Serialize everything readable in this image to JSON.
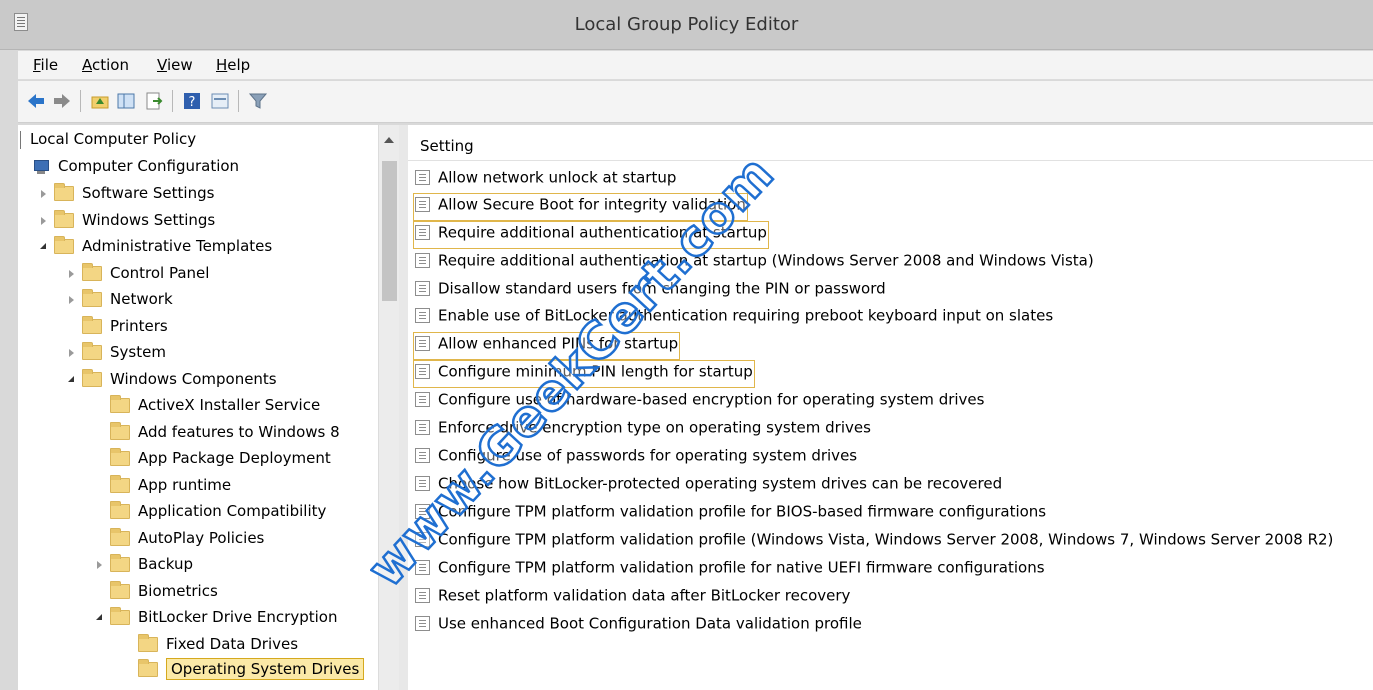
{
  "window": {
    "title": "Local Group Policy Editor"
  },
  "menu": {
    "items": [
      {
        "label": "File",
        "u": "F",
        "rest": "ile"
      },
      {
        "label": "Action",
        "u": "A",
        "rest": "ction"
      },
      {
        "label": "View",
        "u": "V",
        "rest": "iew"
      },
      {
        "label": "Help",
        "u": "H",
        "rest": "elp"
      }
    ]
  },
  "toolbar": {
    "icons": [
      "back-arrow-icon",
      "forward-arrow-icon",
      "up-folder-icon",
      "show-hide-tree-icon",
      "export-list-icon",
      "help-icon",
      "properties-icon",
      "filter-icon"
    ]
  },
  "tree": {
    "items": [
      {
        "label": "Local Computer Policy"
      },
      {
        "label": "Computer Configuration"
      },
      {
        "label": "Software Settings"
      },
      {
        "label": "Windows Settings"
      },
      {
        "label": "Administrative Templates"
      },
      {
        "label": "Control Panel"
      },
      {
        "label": "Network"
      },
      {
        "label": "Printers"
      },
      {
        "label": "System"
      },
      {
        "label": "Windows Components"
      },
      {
        "label": "ActiveX Installer Service"
      },
      {
        "label": "Add features to Windows 8"
      },
      {
        "label": "App Package Deployment"
      },
      {
        "label": "App runtime"
      },
      {
        "label": "Application Compatibility"
      },
      {
        "label": "AutoPlay Policies"
      },
      {
        "label": "Backup"
      },
      {
        "label": "Biometrics"
      },
      {
        "label": "BitLocker Drive Encryption"
      },
      {
        "label": "Fixed Data Drives"
      },
      {
        "label": "Operating System Drives"
      }
    ]
  },
  "list": {
    "column_header": "Setting",
    "settings": [
      {
        "label": "Allow network unlock at startup"
      },
      {
        "label": "Allow Secure Boot for integrity validation"
      },
      {
        "label": "Require additional authentication at startup"
      },
      {
        "label": "Require additional authentication at startup (Windows Server 2008 and Windows Vista)"
      },
      {
        "label": "Disallow standard users from changing the PIN or password"
      },
      {
        "label": "Enable use of BitLocker authentication requiring preboot keyboard input on slates"
      },
      {
        "label": "Allow enhanced PINs for startup"
      },
      {
        "label": "Configure minimum PIN length for startup"
      },
      {
        "label": "Configure use of hardware-based encryption for operating system drives"
      },
      {
        "label": "Enforce drive encryption type on operating system drives"
      },
      {
        "label": "Configure use of passwords for operating system drives"
      },
      {
        "label": "Choose how BitLocker-protected operating system drives can be recovered"
      },
      {
        "label": "Configure TPM platform validation profile for BIOS-based firmware configurations"
      },
      {
        "label": "Configure TPM platform validation profile (Windows Vista, Windows Server 2008, Windows 7, Windows Server 2008 R2)"
      },
      {
        "label": "Configure TPM platform validation profile for native UEFI firmware configurations"
      },
      {
        "label": "Reset platform validation data after BitLocker recovery"
      },
      {
        "label": "Use enhanced Boot Configuration Data validation profile"
      }
    ]
  },
  "watermark": {
    "text": "www.GeekCert.com",
    "color": "#1f6fd1"
  },
  "colors": {
    "highlight_border": "#e0b64b",
    "selection_fill": "#fbe9a7"
  }
}
